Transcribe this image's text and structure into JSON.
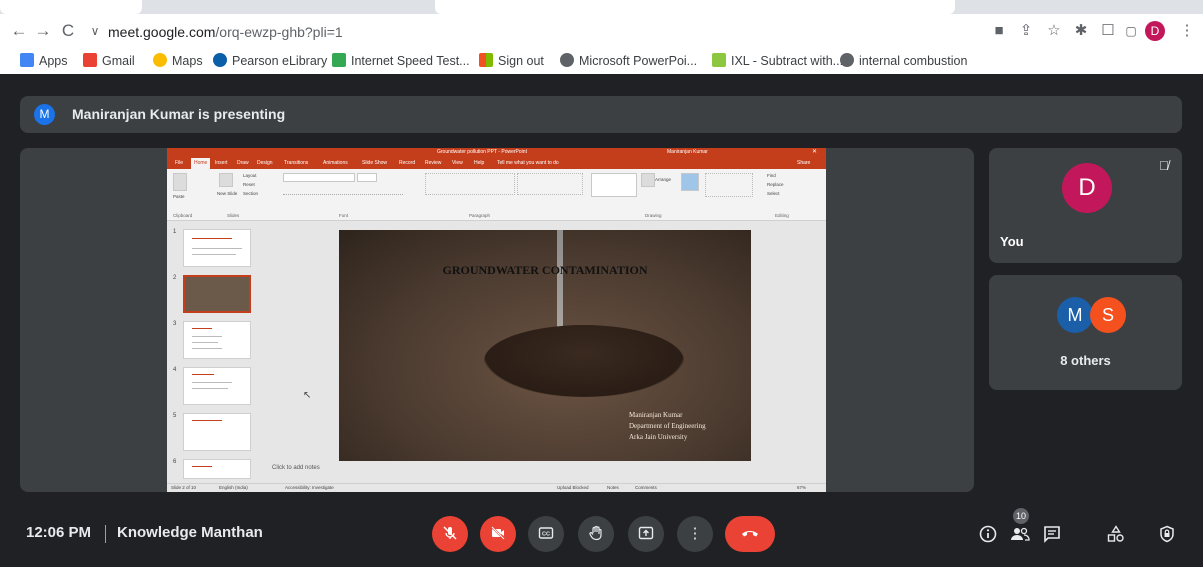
{
  "browser": {
    "url_host": "meet.google.com",
    "url_path": "/orq-ewzp-ghb?pli=1",
    "profile_initial": "D",
    "bookmarks": [
      {
        "label": "Apps",
        "icon": "apps-grid-icon",
        "color": "#4285f4"
      },
      {
        "label": "Gmail",
        "icon": "gmail-icon",
        "color": "#ea4335"
      },
      {
        "label": "Maps",
        "icon": "maps-pin-icon",
        "color": "#fbbc04"
      },
      {
        "label": "Pearson eLibrary",
        "icon": "pearson-icon",
        "color": "#0b5ea8"
      },
      {
        "label": "Internet Speed Test...",
        "icon": "speed-test-icon",
        "color": "#34a853"
      },
      {
        "label": "Sign out",
        "icon": "microsoft-icon",
        "color": "#f25022"
      },
      {
        "label": "Microsoft PowerPoi...",
        "icon": "globe-icon",
        "color": "#5f6368"
      },
      {
        "label": "IXL - Subtract with...",
        "icon": "ixl-icon",
        "color": "#8dc63f"
      },
      {
        "label": "internal combustion",
        "icon": "globe-icon",
        "color": "#5f6368"
      }
    ]
  },
  "meet": {
    "presenter_initial": "M",
    "presenting_text": "Maniranjan Kumar is presenting",
    "you_initial": "D",
    "you_label": "You",
    "others": [
      {
        "initial": "M",
        "color": "#1a5fa8"
      },
      {
        "initial": "S",
        "color": "#f4511e"
      }
    ],
    "others_label": "8 others",
    "time": "12:06 PM",
    "meeting_name": "Knowledge Manthan",
    "participant_count": "10"
  },
  "presentation": {
    "window_title": "Groundwater pollution PPT - PowerPoint",
    "user": "Maniranjan Kumar",
    "tabs": [
      "File",
      "Home",
      "Insert",
      "Draw",
      "Design",
      "Transitions",
      "Animations",
      "Slide Show",
      "Record",
      "Review",
      "View",
      "Help",
      "Tell me what you want to do"
    ],
    "share": "Share",
    "ribbon_groups": [
      "Clipboard",
      "Slides",
      "Font",
      "Paragraph",
      "Drawing",
      "Editing"
    ],
    "ribbon_labels": {
      "paste": "Paste",
      "new_slide": "New Slide",
      "layout": "Layout",
      "reset": "Reset",
      "section": "Section",
      "arrange": "Arrange",
      "find": "Find",
      "replace": "Replace",
      "select": "Select"
    },
    "slide_numbers": [
      "1",
      "2",
      "3",
      "4",
      "5",
      "6"
    ],
    "slide_title": "GROUNDWATER CONTAMINATION",
    "credit_lines": [
      "Maniranjan Kumar",
      "Department of Engineering",
      "Arka Jain University"
    ],
    "notes_placeholder": "Click to add notes",
    "status": {
      "slide_of": "Slide 2 of 10",
      "language": "English (India)",
      "accessibility": "Accessibility: Investigate",
      "upload": "Upload Blocked",
      "notes": "Notes",
      "comments": "Comments",
      "zoom": "67%"
    }
  }
}
